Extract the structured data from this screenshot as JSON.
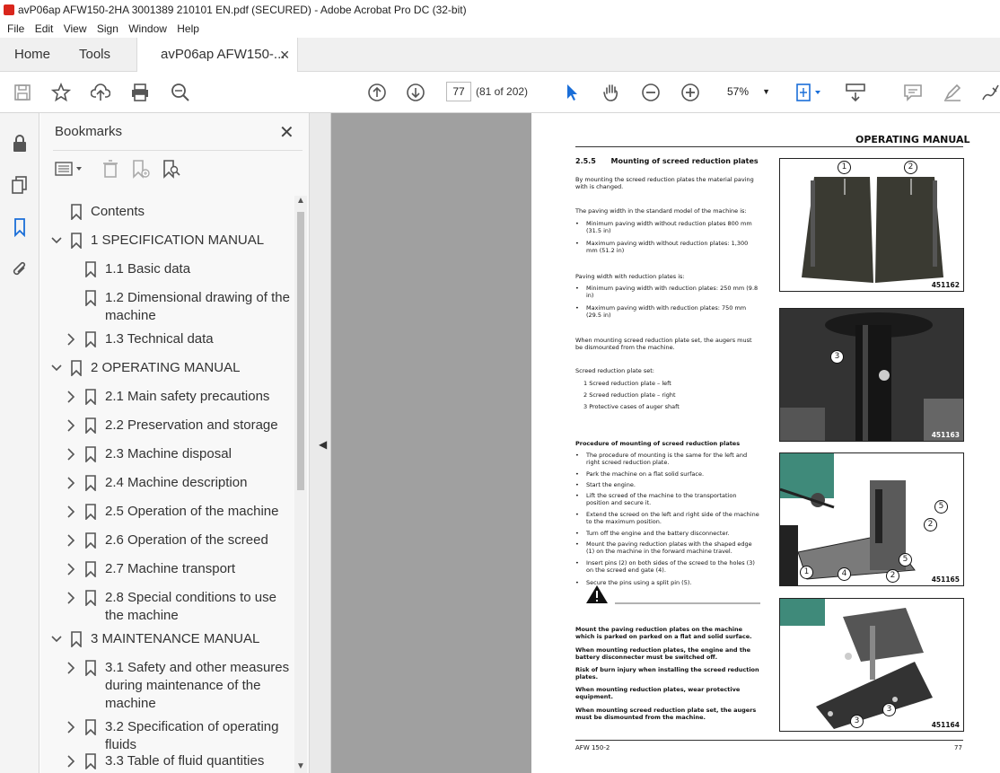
{
  "window": {
    "title": "avP06ap AFW150-2HA 3001389 210101 EN.pdf (SECURED) - Adobe Acrobat Pro DC (32-bit)"
  },
  "menu": [
    "File",
    "Edit",
    "View",
    "Sign",
    "Window",
    "Help"
  ],
  "tabs": {
    "home": "Home",
    "tools": "Tools",
    "doc": "avP06ap AFW150-..."
  },
  "toolbar": {
    "page_value": "77",
    "page_of": "(81 of 202)",
    "zoom": "57%"
  },
  "bookmarks": {
    "title": "Bookmarks",
    "items": [
      {
        "label": "Contents",
        "level": 0,
        "expand": "none"
      },
      {
        "label": "1 SPECIFICATION MANUAL",
        "level": 0,
        "expand": "open"
      },
      {
        "label": "1.1 Basic data",
        "level": 1,
        "expand": "none"
      },
      {
        "label": "1.2 Dimensional drawing of the machine",
        "level": 1,
        "expand": "none"
      },
      {
        "label": "1.3 Technical data",
        "level": 1,
        "expand": "closed"
      },
      {
        "label": "2 OPERATING MANUAL",
        "level": 0,
        "expand": "open"
      },
      {
        "label": "2.1 Main safety precautions",
        "level": 1,
        "expand": "closed"
      },
      {
        "label": "2.2 Preservation and storage",
        "level": 1,
        "expand": "closed"
      },
      {
        "label": "2.3 Machine disposal",
        "level": 1,
        "expand": "closed"
      },
      {
        "label": "2.4 Machine description",
        "level": 1,
        "expand": "closed"
      },
      {
        "label": "2.5 Operation of the machine",
        "level": 1,
        "expand": "closed"
      },
      {
        "label": "2.6 Operation of the screed",
        "level": 1,
        "expand": "closed"
      },
      {
        "label": "2.7 Machine transport",
        "level": 1,
        "expand": "closed"
      },
      {
        "label": "2.8 Special conditions to use the machine",
        "level": 1,
        "expand": "closed"
      },
      {
        "label": "3 MAINTENANCE MANUAL",
        "level": 0,
        "expand": "open"
      },
      {
        "label": "3.1 Safety and other measures during maintenance of the machine",
        "level": 1,
        "expand": "closed"
      },
      {
        "label": "3.2 Specification of operating fluids",
        "level": 1,
        "expand": "closed"
      },
      {
        "label": "3.3 Table of fluid quantities",
        "level": 1,
        "expand": "closed"
      }
    ]
  },
  "doc": {
    "header": "OPERATING MANUAL",
    "section_num": "2.5.5",
    "section_title": "Mounting of screed reduction plates",
    "intro": "By mounting the screed reduction plates the material paving with is changed.",
    "std_title": "The paving width in the standard model of the machine is:",
    "std_bullets": [
      "Minimum paving width without reduction plates 800 mm (31.5 in)",
      "Maximum paving width without reduction plates: 1,300 mm (51.2 in)"
    ],
    "red_title": "Paving width with reduction plates is:",
    "red_bullets": [
      "Minimum paving width with reduction plates: 250 mm (9.8 in)",
      "Maximum paving width with reduction plates: 750 mm (29.5 in)"
    ],
    "augers_note": "When mounting screed reduction plate set, the augers must be dismounted from the machine.",
    "set_title": "Screed reduction plate set:",
    "set_items": [
      "1  Screed reduction plate – left",
      "2  Screed reduction plate – right",
      "3  Protective cases of auger shaft"
    ],
    "proc_title": "Procedure of mounting of screed reduction plates",
    "proc_bullets": [
      "The procedure of mounting is the same for the left and right screed reduction plate.",
      "Park the machine on a flat solid surface.",
      "Start the engine.",
      "Lift the screed of the machine to the transportation position and secure it.",
      "Extend the screed on the left and right side of the machine to the maximum position.",
      "Turn off the engine and the battery disconnecter.",
      "Mount the paving reduction plates with the shaped edge (1) on the machine in the forward machine travel.",
      "Insert pins (2) on both sides of the screed to the holes (3) on the screed end gate (4).",
      "Secure the pins using a split pin (5)."
    ],
    "warnings": [
      "Mount the paving reduction plates on the machine which is parked on parked on a flat and solid surface.",
      "When mounting reduction plates, the engine and the battery disconnecter must be switched off.",
      "Risk of burn injury when installing the screed reduction plates.",
      "When mounting reduction plates, wear protective equipment.",
      "When mounting screed reduction plate set, the augers must be dismounted from the machine."
    ],
    "figs": [
      "451162",
      "451163",
      "451165",
      "451164"
    ],
    "footer_left": "AFW 150-2",
    "footer_right": "77",
    "callouts": {
      "c1": "1",
      "c2": "2",
      "c3": "3",
      "c4": "4",
      "c5": "5"
    }
  }
}
